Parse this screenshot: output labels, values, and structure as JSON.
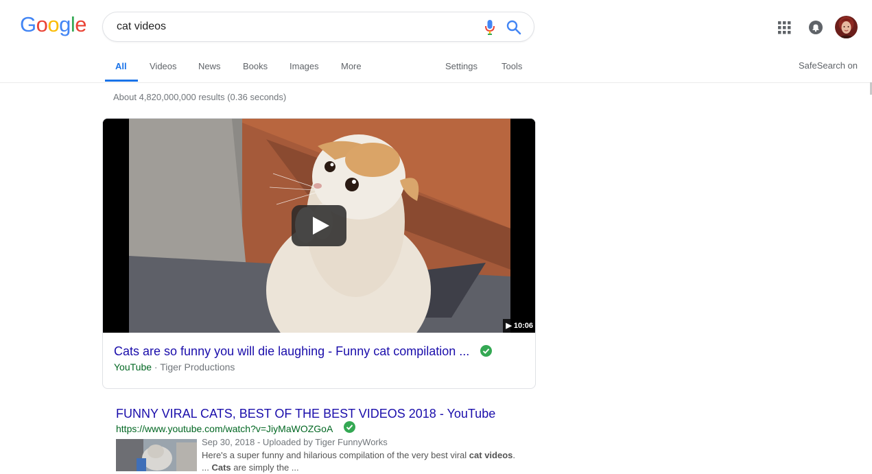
{
  "logo": {
    "text": "Google"
  },
  "search": {
    "query": "cat videos"
  },
  "tabs": [
    {
      "label": "All"
    },
    {
      "label": "Videos"
    },
    {
      "label": "News"
    },
    {
      "label": "Books"
    },
    {
      "label": "Images"
    },
    {
      "label": "More"
    },
    {
      "label": "Settings"
    },
    {
      "label": "Tools"
    }
  ],
  "safesearch": {
    "label": "SafeSearch on"
  },
  "result_stats": "About 4,820,000,000 results (0.36 seconds)",
  "video_result": {
    "duration": "10:06",
    "title": "Cats are so funny you will die laughing - Funny cat compilation ...",
    "site": "YouTube",
    "separator": "·",
    "channel": "Tiger Productions"
  },
  "result2": {
    "title": "FUNNY VIRAL CATS, BEST OF THE BEST VIDEOS 2018 - YouTube",
    "url": "https://www.youtube.com/watch?v=JiyMaWOZGoA",
    "meta": "Sep 30, 2018 - Uploaded by Tiger FunnyWorks",
    "snippet_1": "Here's a super funny and hilarious compilation of the very best viral ",
    "snippet_bold_1": "cat videos",
    "snippet_2": ".",
    "snippet_3": "... ",
    "snippet_bold_2": "Cats",
    "snippet_4": " are simply the ..."
  },
  "colors": {
    "link": "#1a0dab",
    "url_green": "#006621",
    "active_tab": "#1a73e8",
    "verified": "#34a853"
  }
}
